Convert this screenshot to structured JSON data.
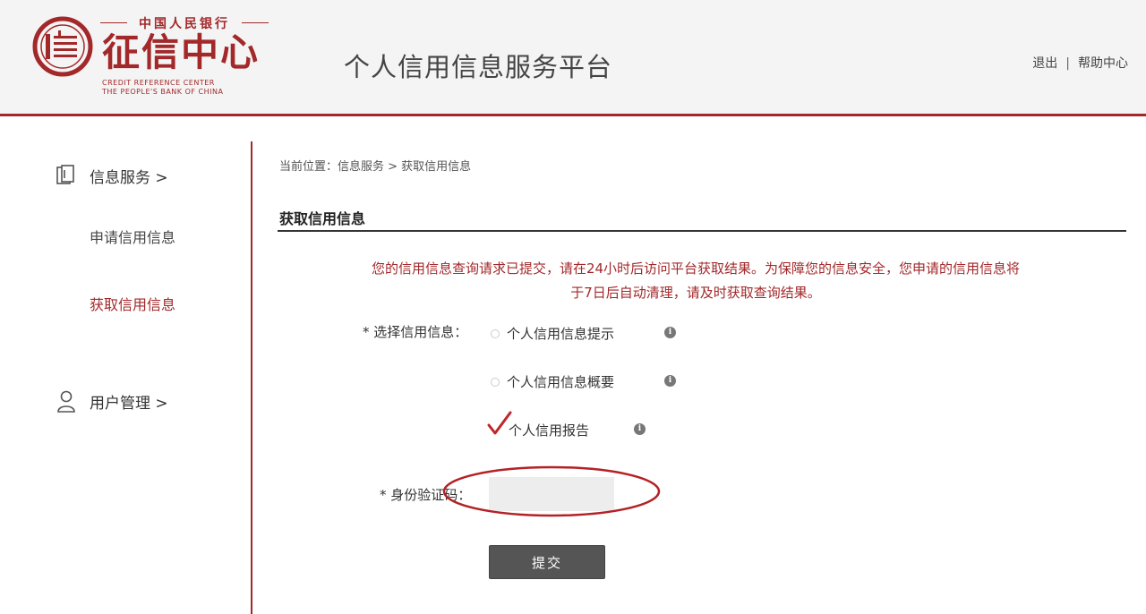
{
  "header": {
    "logo_top_text": "中国人民银行",
    "logo_main_text": "征信中心",
    "logo_en_line1": "CREDIT REFERENCE CENTER",
    "logo_en_line2": "THE PEOPLE'S BANK OF CHINA",
    "platform_title": "个人信用信息服务平台",
    "logout_label": "退出",
    "separator": "|",
    "help_label": "帮助中心",
    "brand_color": "#a3282a"
  },
  "sidebar": {
    "group_info": {
      "label": "信息服务 >",
      "icon": "card-icon"
    },
    "sub_items": [
      {
        "label": "申请信用信息"
      },
      {
        "label": "获取信用信息"
      }
    ],
    "group_user": {
      "label": "用户管理 >",
      "icon": "user-icon"
    }
  },
  "main": {
    "breadcrumb": "当前位置：信息服务 > 获取信用信息",
    "section_title": "获取信用信息",
    "notice_line1": "您的信用信息查询请求已提交，请在24小时后访问平台获取结果。为保障您的信息安全，您申请的信用信息将",
    "notice_line2": "于7日后自动清理，请及时获取查询结果。",
    "select_label": "* 选择信用信息：",
    "options": [
      {
        "label": "个人信用信息提示",
        "selected": false
      },
      {
        "label": "个人信用信息概要",
        "selected": false
      },
      {
        "label": "个人信用报告",
        "selected": true
      }
    ],
    "id_code_label": "* 身份验证码：",
    "id_code_value": "",
    "submit_label": "提交"
  }
}
